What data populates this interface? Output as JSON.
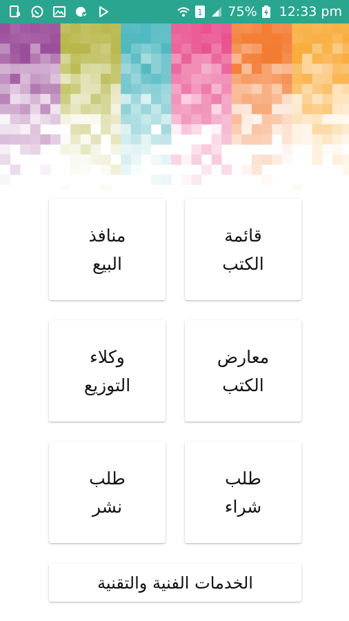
{
  "status_bar": {
    "battery": "75%",
    "time": "12:33 pm",
    "sim_slot": "1",
    "left_icons": [
      "download-icon",
      "whatsapp-icon",
      "image-icon",
      "notification-icon",
      "play-store-icon"
    ],
    "right_icons": [
      "wifi-icon",
      "sim-icon",
      "signal-icon",
      "battery-charging-icon"
    ]
  },
  "banner": {
    "colors": [
      "#9b4f9a",
      "#b7b74a",
      "#4fb8c0",
      "#e8508e",
      "#f37c33",
      "#f8ad3d"
    ]
  },
  "menu": {
    "book_list": {
      "line1": "قائمة",
      "line2": "الكتب"
    },
    "sales_outlets": {
      "line1": "منافذ",
      "line2": "البيع"
    },
    "book_fairs": {
      "line1": "معارض",
      "line2": "الكتب"
    },
    "distributors": {
      "line1": "وكلاء",
      "line2": "التوزيع"
    },
    "purchase_request": {
      "line1": "طلب",
      "line2": "شراء"
    },
    "publish_request": {
      "line1": "طلب",
      "line2": "نشر"
    },
    "services": "الخدمات الفنية والتقنية"
  }
}
